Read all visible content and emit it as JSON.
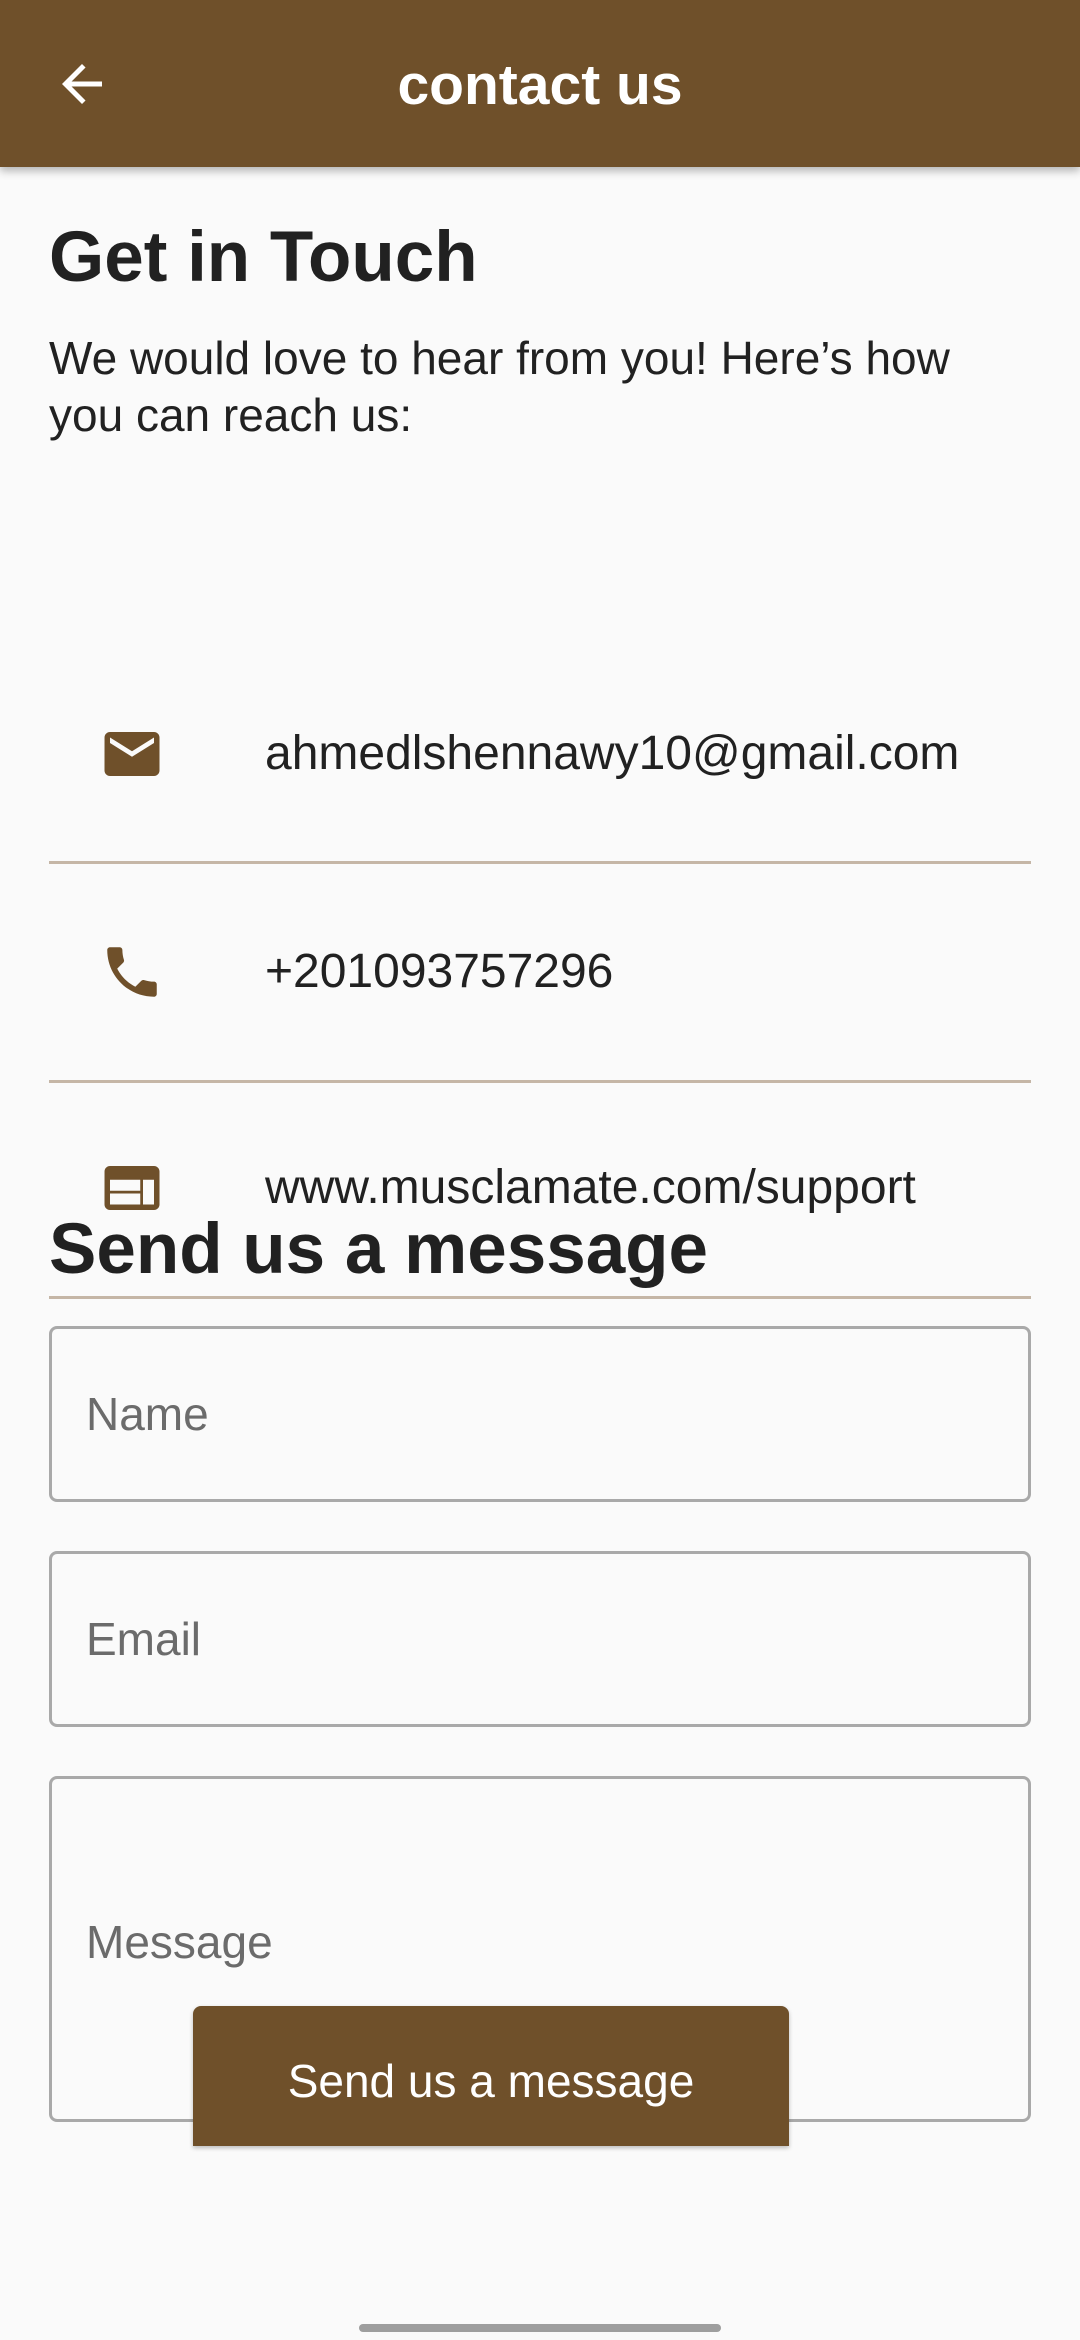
{
  "app_bar": {
    "title": "contact us",
    "background_color": "#6f502a",
    "back_icon": "arrow-back-icon"
  },
  "intro": {
    "heading": "Get in Touch",
    "text": "We would love to hear from you! Here’s how you can reach us:"
  },
  "contacts": [
    {
      "icon": "mail-icon",
      "value": "ahmedlshennawy10@gmail.com"
    },
    {
      "icon": "phone-icon",
      "value": "+201093757296"
    },
    {
      "icon": "web-icon",
      "value": "www.musclamate.com/support"
    }
  ],
  "form": {
    "heading": "Send us a message",
    "name_placeholder": "Name",
    "name_value": "",
    "email_placeholder": "Email",
    "email_value": "",
    "message_placeholder": "Message",
    "message_value": "",
    "submit_label": "Send us a message"
  },
  "colors": {
    "accent": "#6f502a",
    "divider": "#c5b6a6",
    "background": "#fafafa"
  }
}
